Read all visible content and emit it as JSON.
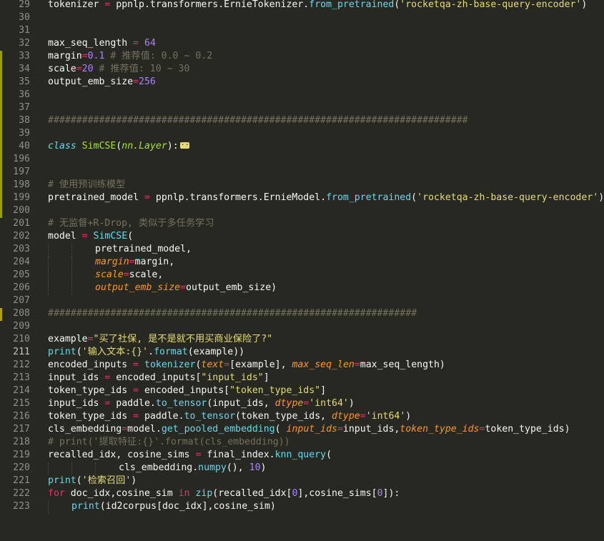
{
  "editor": {
    "theme": {
      "background": "#272822",
      "text": "#f8f8f2",
      "line_number": "#8f908a",
      "line_number_current": "#c2c2bf",
      "comment": "#75715e",
      "string": "#e6db74",
      "number": "#ae81ff",
      "operator": "#f92672",
      "function": "#66d9ef",
      "class_name": "#a6e22e",
      "param": "#fd971f",
      "gutter_modified": "#9c9c00"
    },
    "current_line": "211",
    "lines": [
      {
        "n": "29",
        "mark": "",
        "tokens": [
          [
            "tokenizer ",
            "t"
          ],
          [
            "=",
            "o"
          ],
          [
            " ppnlp.transformers.ErnieTokenizer.",
            "t"
          ],
          [
            "from_pretrained",
            "f"
          ],
          [
            "(",
            "t"
          ],
          [
            "'rocketqa-zh-base-query-encoder'",
            "s"
          ],
          [
            ")",
            "t"
          ]
        ]
      },
      {
        "n": "30",
        "mark": "",
        "tokens": []
      },
      {
        "n": "31",
        "mark": "",
        "tokens": []
      },
      {
        "n": "32",
        "mark": "",
        "tokens": [
          [
            "max_seq_length ",
            "t"
          ],
          [
            "=",
            "o"
          ],
          [
            " ",
            "t"
          ],
          [
            "64",
            "n"
          ]
        ]
      },
      {
        "n": "33",
        "mark": "green",
        "tokens": [
          [
            "margin",
            "t"
          ],
          [
            "=",
            "o"
          ],
          [
            "0.1",
            "n"
          ],
          [
            " # 推荐值: 0.0 ~ 0.2",
            "c"
          ]
        ]
      },
      {
        "n": "34",
        "mark": "green",
        "tokens": [
          [
            "scale",
            "t"
          ],
          [
            "=",
            "o"
          ],
          [
            "20",
            "n"
          ],
          [
            " # 推荐值: 10 ~ 30",
            "c"
          ]
        ]
      },
      {
        "n": "35",
        "mark": "green",
        "tokens": [
          [
            "output_emb_size",
            "t"
          ],
          [
            "=",
            "o"
          ],
          [
            "256",
            "n"
          ]
        ]
      },
      {
        "n": "36",
        "mark": "green",
        "tokens": []
      },
      {
        "n": "37",
        "mark": "green",
        "tokens": []
      },
      {
        "n": "38",
        "mark": "green",
        "tokens": [
          [
            "##########################################################################",
            "c"
          ]
        ]
      },
      {
        "n": "39",
        "mark": "green",
        "tokens": []
      },
      {
        "n": "40",
        "mark": "green",
        "tokens": [
          [
            "class",
            "kw"
          ],
          [
            " ",
            "t"
          ],
          [
            "SimCSE",
            "cl"
          ],
          [
            "(",
            "t"
          ],
          [
            "nn.Layer",
            "it"
          ],
          [
            "):",
            "t"
          ]
        ],
        "fold": true
      },
      {
        "n": "196",
        "mark": "green",
        "tokens": []
      },
      {
        "n": "197",
        "mark": "green",
        "tokens": []
      },
      {
        "n": "198",
        "mark": "green",
        "tokens": [
          [
            "# 使用预训练模型",
            "c"
          ]
        ]
      },
      {
        "n": "199",
        "mark": "green",
        "tokens": [
          [
            "pretrained_model ",
            "t"
          ],
          [
            "=",
            "o"
          ],
          [
            " ppnlp.transformers.ErnieModel.",
            "t"
          ],
          [
            "from_pretrained",
            "f"
          ],
          [
            "(",
            "t"
          ],
          [
            "'rocketqa-zh-base-query-encoder'",
            "s"
          ],
          [
            ")",
            "t"
          ]
        ]
      },
      {
        "n": "200",
        "mark": "green",
        "tokens": []
      },
      {
        "n": "201",
        "mark": "",
        "tokens": [
          [
            "# 无监督+R-Drop, 类似于多任务学习",
            "c"
          ]
        ]
      },
      {
        "n": "202",
        "mark": "",
        "tokens": [
          [
            "model ",
            "t"
          ],
          [
            "=",
            "o"
          ],
          [
            " ",
            "t"
          ],
          [
            "SimCSE",
            "f"
          ],
          [
            "(",
            "t"
          ]
        ]
      },
      {
        "n": "203",
        "mark": "",
        "indent": 2,
        "tokens": [
          [
            "pretrained_model,",
            "t"
          ]
        ]
      },
      {
        "n": "204",
        "mark": "",
        "indent": 2,
        "tokens": [
          [
            "margin",
            "p"
          ],
          [
            "=",
            "o"
          ],
          [
            "margin,",
            "t"
          ]
        ]
      },
      {
        "n": "205",
        "mark": "",
        "indent": 2,
        "tokens": [
          [
            "scale",
            "p"
          ],
          [
            "=",
            "o"
          ],
          [
            "scale,",
            "t"
          ]
        ]
      },
      {
        "n": "206",
        "mark": "",
        "indent": 2,
        "tokens": [
          [
            "output_emb_size",
            "p"
          ],
          [
            "=",
            "o"
          ],
          [
            "output_emb_size)",
            "t"
          ]
        ]
      },
      {
        "n": "207",
        "mark": "",
        "tokens": []
      },
      {
        "n": "208",
        "mark": "yellow",
        "tokens": [
          [
            "#################################################################",
            "c"
          ]
        ]
      },
      {
        "n": "209",
        "mark": "",
        "tokens": []
      },
      {
        "n": "210",
        "mark": "",
        "tokens": [
          [
            "example",
            "t"
          ],
          [
            "=",
            "o"
          ],
          [
            "\"买了社保, 是不是就不用买商业保险了?\"",
            "s"
          ]
        ]
      },
      {
        "n": "211",
        "mark": "",
        "current": true,
        "tokens": [
          [
            "print",
            "f"
          ],
          [
            "(",
            "t"
          ],
          [
            "'输入文本:{}'",
            "s"
          ],
          [
            ".",
            "t"
          ],
          [
            "format",
            "f"
          ],
          [
            "(example))",
            "t"
          ]
        ]
      },
      {
        "n": "212",
        "mark": "",
        "tokens": [
          [
            "encoded_inputs ",
            "t"
          ],
          [
            "=",
            "o"
          ],
          [
            " ",
            "t"
          ],
          [
            "tokenizer",
            "f"
          ],
          [
            "(",
            "t"
          ],
          [
            "text",
            "p"
          ],
          [
            "=",
            "o"
          ],
          [
            "[example], ",
            "t"
          ],
          [
            "max_seq_len",
            "p"
          ],
          [
            "=",
            "o"
          ],
          [
            "max_seq_length)",
            "t"
          ]
        ]
      },
      {
        "n": "213",
        "mark": "",
        "tokens": [
          [
            "input_ids ",
            "t"
          ],
          [
            "=",
            "o"
          ],
          [
            " encoded_inputs[",
            "t"
          ],
          [
            "\"input_ids\"",
            "s"
          ],
          [
            "]",
            "t"
          ]
        ]
      },
      {
        "n": "214",
        "mark": "",
        "tokens": [
          [
            "token_type_ids ",
            "t"
          ],
          [
            "=",
            "o"
          ],
          [
            " encoded_inputs[",
            "t"
          ],
          [
            "\"token_type_ids\"",
            "s"
          ],
          [
            "]",
            "t"
          ]
        ]
      },
      {
        "n": "215",
        "mark": "",
        "tokens": [
          [
            "input_ids ",
            "t"
          ],
          [
            "=",
            "o"
          ],
          [
            " paddle.",
            "t"
          ],
          [
            "to_tensor",
            "f"
          ],
          [
            "(input_ids, ",
            "t"
          ],
          [
            "dtype",
            "p"
          ],
          [
            "=",
            "o"
          ],
          [
            "'int64'",
            "s"
          ],
          [
            ")",
            "t"
          ]
        ]
      },
      {
        "n": "216",
        "mark": "",
        "tokens": [
          [
            "token_type_ids ",
            "t"
          ],
          [
            "=",
            "o"
          ],
          [
            " paddle.",
            "t"
          ],
          [
            "to_tensor",
            "f"
          ],
          [
            "(token_type_ids, ",
            "t"
          ],
          [
            "dtype",
            "p"
          ],
          [
            "=",
            "o"
          ],
          [
            "'int64'",
            "s"
          ],
          [
            ")",
            "t"
          ]
        ]
      },
      {
        "n": "217",
        "mark": "",
        "tokens": [
          [
            "cls_embedding",
            "t"
          ],
          [
            "=",
            "o"
          ],
          [
            "model.",
            "t"
          ],
          [
            "get_pooled_embedding",
            "f"
          ],
          [
            "( ",
            "t"
          ],
          [
            "input_ids",
            "p"
          ],
          [
            "=",
            "o"
          ],
          [
            "input_ids,",
            "t"
          ],
          [
            "token_type_ids",
            "p"
          ],
          [
            "=",
            "o"
          ],
          [
            "token_type_ids)",
            "t"
          ]
        ]
      },
      {
        "n": "218",
        "mark": "",
        "tokens": [
          [
            "# print('提取特征:{}'.format(cls_embedding))",
            "c"
          ]
        ]
      },
      {
        "n": "219",
        "mark": "",
        "tokens": [
          [
            "recalled_idx, cosine_sims ",
            "t"
          ],
          [
            "=",
            "o"
          ],
          [
            " final_index.",
            "t"
          ],
          [
            "knn_query",
            "f"
          ],
          [
            "(",
            "t"
          ]
        ]
      },
      {
        "n": "220",
        "mark": "",
        "indent": 3,
        "tokens": [
          [
            "cls_embedding.",
            "t"
          ],
          [
            "numpy",
            "f"
          ],
          [
            "(), ",
            "t"
          ],
          [
            "10",
            "n"
          ],
          [
            ")",
            "t"
          ]
        ]
      },
      {
        "n": "221",
        "mark": "",
        "tokens": [
          [
            "print",
            "f"
          ],
          [
            "(",
            "t"
          ],
          [
            "'检索召回'",
            "s"
          ],
          [
            ")",
            "t"
          ]
        ]
      },
      {
        "n": "222",
        "mark": "",
        "tokens": [
          [
            "for",
            "o"
          ],
          [
            " doc_idx,cosine_sim ",
            "t"
          ],
          [
            "in",
            "o"
          ],
          [
            " ",
            "t"
          ],
          [
            "zip",
            "f"
          ],
          [
            "(recalled_idx[",
            "t"
          ],
          [
            "0",
            "n"
          ],
          [
            "],cosine_sims[",
            "t"
          ],
          [
            "0",
            "n"
          ],
          [
            "]):",
            "t"
          ]
        ]
      },
      {
        "n": "223",
        "mark": "",
        "indent": 1,
        "tokens": [
          [
            "print",
            "f"
          ],
          [
            "(id2corpus[doc_idx],cosine_sim)",
            "t"
          ]
        ]
      }
    ]
  }
}
